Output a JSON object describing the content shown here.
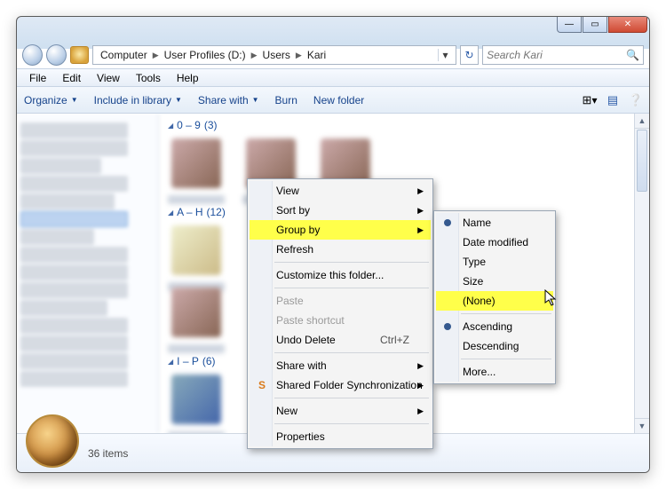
{
  "window_controls": {
    "min": "—",
    "max": "▭",
    "close": "✕"
  },
  "breadcrumb": {
    "root": "Computer",
    "d": "User Profiles (D:)",
    "users": "Users",
    "kari": "Kari"
  },
  "search": {
    "placeholder": "Search Kari"
  },
  "menubar": {
    "file": "File",
    "edit": "Edit",
    "view": "View",
    "tools": "Tools",
    "help": "Help"
  },
  "toolbar": {
    "organize": "Organize",
    "include": "Include in library",
    "share": "Share with",
    "burn": "Burn",
    "newfolder": "New folder"
  },
  "bands": {
    "b1_label": "0 – 9",
    "b1_count": "(3)",
    "b2_label": "A – H",
    "b2_count": "(12)",
    "b3_label": "I – P",
    "b3_count": "(6)"
  },
  "status": {
    "items": "36 items"
  },
  "ctx1": {
    "view": "View",
    "sortby": "Sort by",
    "groupby": "Group by",
    "refresh": "Refresh",
    "customize": "Customize this folder...",
    "paste": "Paste",
    "paste_shortcut": "Paste shortcut",
    "undo": "Undo Delete",
    "undo_short": "Ctrl+Z",
    "sharewith": "Share with",
    "sfs": "Shared Folder Synchronization",
    "new": "New",
    "properties": "Properties"
  },
  "ctx2": {
    "name": "Name",
    "date": "Date modified",
    "type": "Type",
    "size": "Size",
    "none": "(None)",
    "asc": "Ascending",
    "desc": "Descending",
    "more": "More..."
  }
}
